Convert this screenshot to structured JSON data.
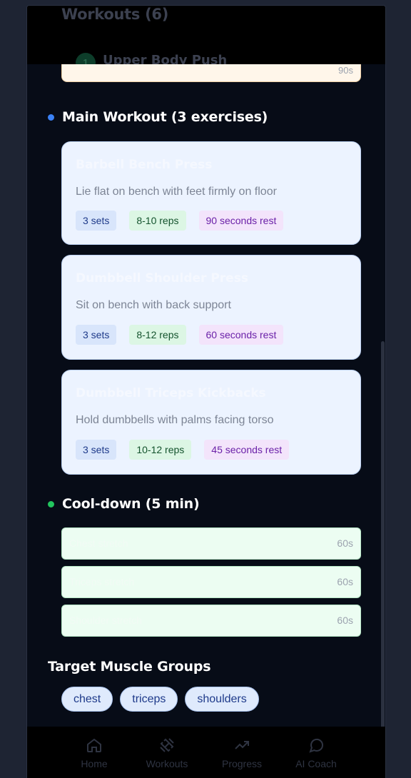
{
  "background": {
    "title": "Workouts (6)",
    "item_number": "1",
    "item_name": "Upper Body Push"
  },
  "warmup": {
    "last_duration": "90s"
  },
  "main": {
    "heading": "Main Workout (3 exercises)",
    "exercises": [
      {
        "name": "Barbell Bench Press",
        "description": "Lie flat on bench with feet firmly on floor",
        "sets": "3 sets",
        "reps": "8-10 reps",
        "rest": "90 seconds rest"
      },
      {
        "name": "Dumbbell Shoulder Press",
        "description": "Sit on bench with back support",
        "sets": "3 sets",
        "reps": "8-12 reps",
        "rest": "60 seconds rest"
      },
      {
        "name": "Dumbbell Triceps Kickbacks",
        "description": "Hold dumbbells with palms facing torso",
        "sets": "3 sets",
        "reps": "10-12 reps",
        "rest": "45 seconds rest"
      }
    ]
  },
  "cooldown": {
    "heading": "Cool-down (5 min)",
    "items": [
      {
        "name": "Chest stretch",
        "duration": "60s"
      },
      {
        "name": "Triceps stretch",
        "duration": "60s"
      },
      {
        "name": "Shoulder stretch",
        "duration": "60s"
      }
    ]
  },
  "muscles": {
    "heading": "Target Muscle Groups",
    "groups": [
      "chest",
      "triceps",
      "shoulders"
    ]
  },
  "nav": [
    {
      "label": "Home",
      "icon": "home-icon"
    },
    {
      "label": "Workouts",
      "icon": "dumbbell-icon"
    },
    {
      "label": "Progress",
      "icon": "trending-up-icon"
    },
    {
      "label": "AI Coach",
      "icon": "chat-bubble-icon"
    }
  ],
  "colors": {
    "main_dot": "#3b82f6",
    "cooldown_dot": "#22c55e",
    "sets_chip": "#d8e5fb",
    "reps_chip": "#dcf6e4",
    "rest_chip": "#f3e4fb"
  }
}
